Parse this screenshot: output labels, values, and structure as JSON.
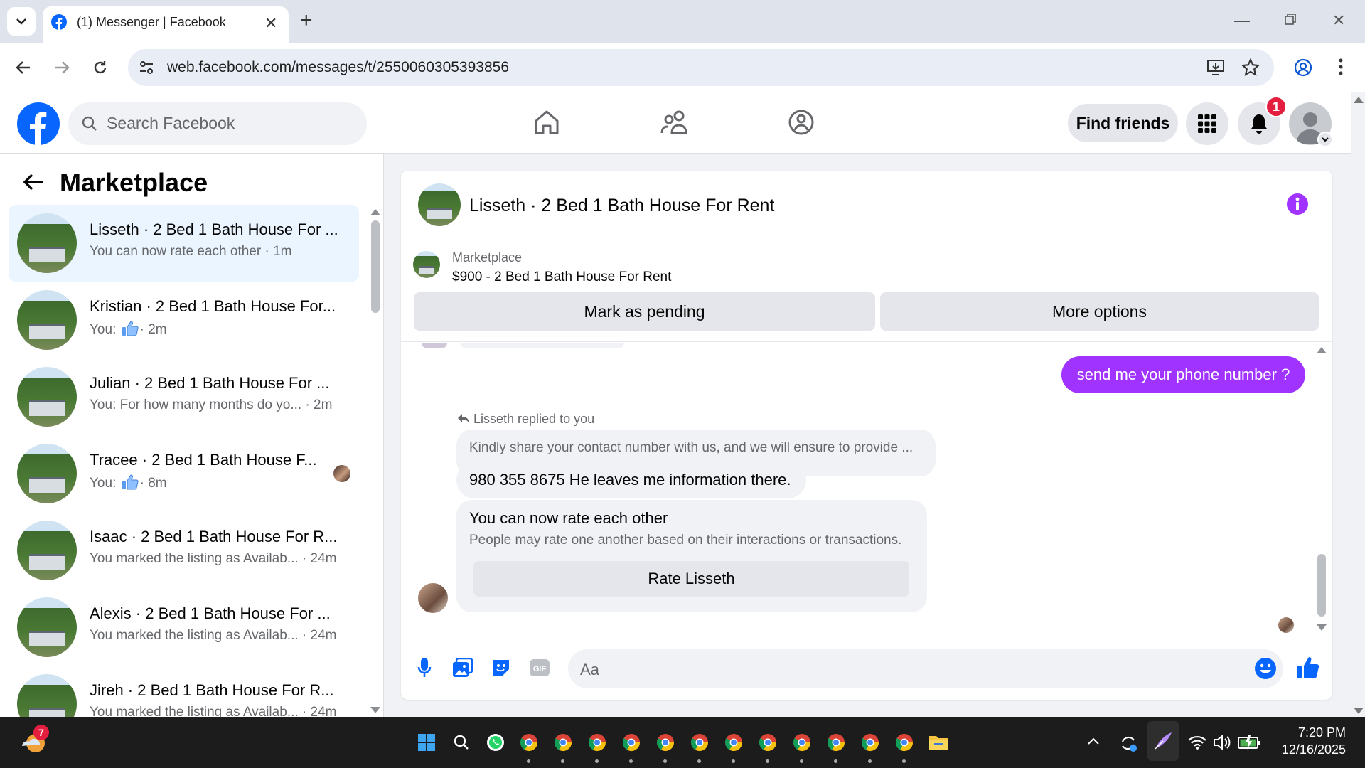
{
  "browser": {
    "tab_title": "(1) Messenger | Facebook",
    "url": "web.facebook.com/messages/t/2550060305393856"
  },
  "fb": {
    "search_placeholder": "Search Facebook",
    "find_friends": "Find friends",
    "notification_count": "1"
  },
  "left": {
    "title": "Marketplace",
    "conversations": [
      {
        "name": "Lisseth · 2 Bed 1 Bath House For ...",
        "sub": "You can now rate each other · 1m",
        "active": true
      },
      {
        "name": "Kristian · 2 Bed 1 Bath House For...",
        "sub": "You: ",
        "time": "· 2m"
      },
      {
        "name": "Julian · 2 Bed 1 Bath House For ...",
        "sub": "You: For how many months do yo...  · 2m"
      },
      {
        "name": "Tracee · 2 Bed 1 Bath House F...",
        "sub": "You: ",
        "time": "· 8m"
      },
      {
        "name": "Isaac · 2 Bed 1 Bath House For R...",
        "sub": "You marked the listing as Availab... · 24m"
      },
      {
        "name": "Alexis · 2 Bed 1 Bath House For ...",
        "sub": "You marked the listing as Availab... · 24m"
      },
      {
        "name": "Jireh · 2 Bed 1 Bath House For R...",
        "sub": "You marked the listing as Availab... · 24m"
      }
    ]
  },
  "chat": {
    "title": "Lisseth · 2 Bed 1 Bath House For Rent",
    "marketplace_label": "Marketplace",
    "listing": "$900 - 2 Bed 1 Bath House For Rent",
    "mark_pending": "Mark as pending",
    "more_options": "More options",
    "outgoing_msg": "send me your phone number ?",
    "replied_label": "Lisseth replied to you",
    "quoted_msg": "Kindly share your contact number with us, and we will ensure to provide ...",
    "incoming_msg": "980 355 8675 He leaves me information there.",
    "rate_title": "You can now rate each other",
    "rate_desc": "People may rate one another based on their interactions or transactions.",
    "rate_button": "Rate Lisseth",
    "compose_placeholder": "Aa"
  },
  "taskbar": {
    "weather_badge": "7",
    "time": "7:20 PM",
    "date": "12/16/2025"
  },
  "colors": {
    "fb_blue": "#0866ff",
    "messenger_purple": "#a033ff",
    "active_conv_bg": "#ebf5ff"
  }
}
